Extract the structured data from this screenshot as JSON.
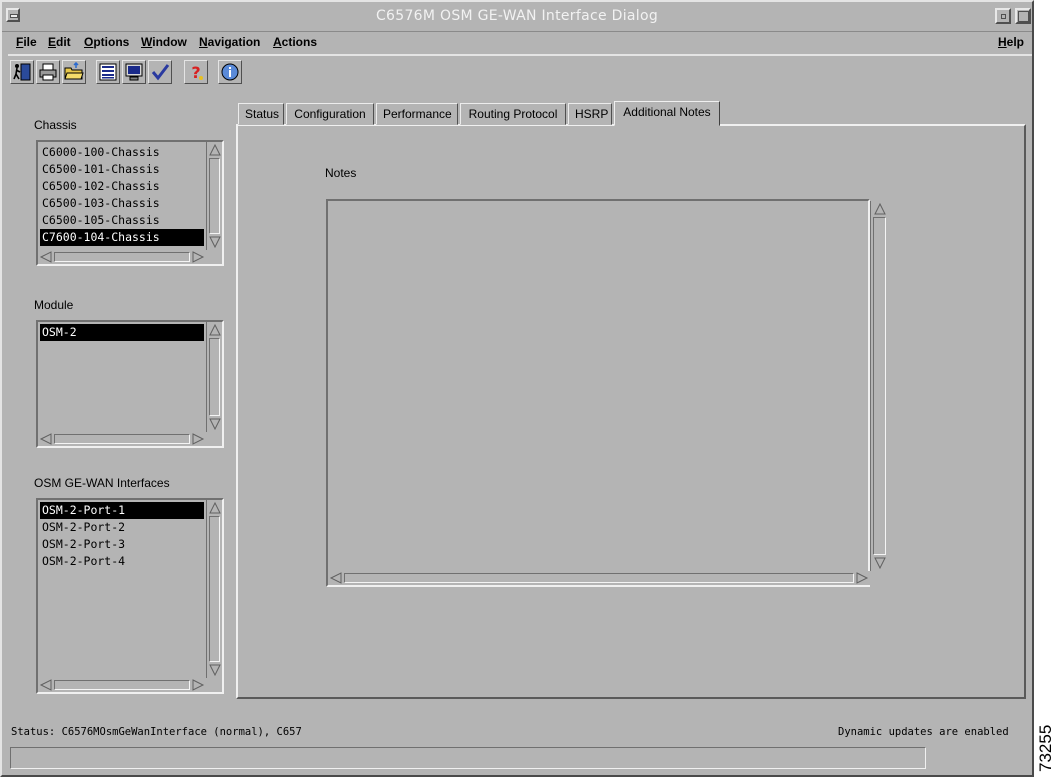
{
  "window": {
    "title": "C6576M OSM GE-WAN Interface Dialog"
  },
  "menubar": {
    "items": [
      {
        "prefix": "F",
        "rest": "ile"
      },
      {
        "prefix": "E",
        "rest": "dit"
      },
      {
        "prefix": "O",
        "rest": "ptions"
      },
      {
        "prefix": "W",
        "rest": "indow"
      },
      {
        "prefix": "N",
        "rest": "avigation"
      },
      {
        "prefix": "A",
        "rest": "ctions"
      }
    ],
    "help": {
      "prefix": "H",
      "rest": "elp"
    }
  },
  "toolbar": {
    "icons": [
      "exit-icon",
      "print-icon",
      "open-folder-icon",
      "list-icon",
      "monitor-icon",
      "checkmark-icon",
      "help-question-icon",
      "info-icon"
    ]
  },
  "chassis": {
    "label": "Chassis",
    "items": [
      "C6000-100-Chassis",
      "C6500-101-Chassis",
      "C6500-102-Chassis",
      "C6500-103-Chassis",
      "C6500-105-Chassis",
      "C7600-104-Chassis"
    ],
    "selected_index": 5
  },
  "module": {
    "label": "Module",
    "items": [
      "OSM-2"
    ],
    "selected_index": 0
  },
  "interfaces": {
    "label": "OSM GE-WAN Interfaces",
    "items": [
      "OSM-2-Port-1",
      "OSM-2-Port-2",
      "OSM-2-Port-3",
      "OSM-2-Port-4"
    ],
    "selected_index": 0
  },
  "tabs": [
    {
      "label": "Status"
    },
    {
      "label": "Configuration"
    },
    {
      "label": "Performance"
    },
    {
      "label": "Routing Protocol"
    },
    {
      "label": "HSRP"
    },
    {
      "label": "Additional Notes"
    }
  ],
  "active_tab": 5,
  "notes": {
    "label": "Notes",
    "value": ""
  },
  "status": {
    "text": "Status: C6576MOsmGeWanInterface (normal), C657",
    "dynamic": "Dynamic updates are enabled"
  },
  "figure_id": "73255"
}
